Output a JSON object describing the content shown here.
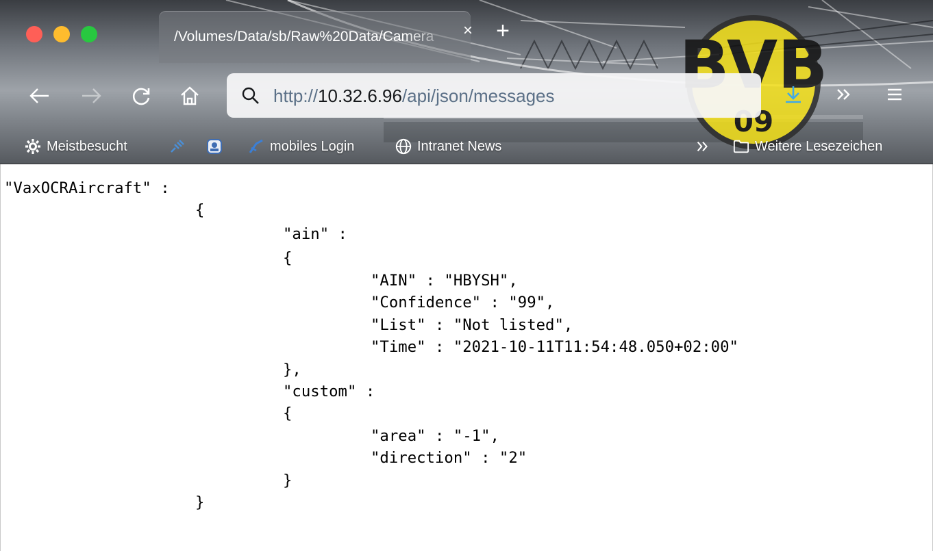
{
  "window": {
    "controls": [
      "close",
      "minimize",
      "maximize"
    ],
    "traffic_colors": {
      "close": "#fe5f57",
      "minimize": "#febc2e",
      "maximize": "#28c840"
    }
  },
  "tab": {
    "title": "/Volumes/Data/sb/Raw%20Data/Camera",
    "close_icon": "close-icon",
    "new_tab_icon": "plus-icon"
  },
  "toolbar": {
    "back_icon": "back-arrow-icon",
    "forward_icon": "forward-arrow-icon",
    "reload_icon": "reload-icon",
    "home_icon": "home-icon",
    "downloads_icon": "download-icon",
    "overflow_icon": "chevron-double-right-icon",
    "menu_icon": "hamburger-menu-icon"
  },
  "url": {
    "scheme": "http://",
    "host": "10.32.6.96",
    "path": "/api/json/messages"
  },
  "bookmarks": {
    "items": [
      {
        "label": "Meistbesucht",
        "icon": "gear-icon"
      },
      {
        "label": "",
        "icon": "link-favicon-icon"
      },
      {
        "label": "",
        "icon": "app-favicon-icon"
      },
      {
        "label": "mobiles Login",
        "icon": "mobiles-login-favicon-icon"
      },
      {
        "label": "Intranet News",
        "icon": "globe-icon"
      }
    ],
    "overflow_icon": "chevron-double-right-icon",
    "other_bookmarks": "Weitere Lesezeichen",
    "other_bookmarks_icon": "folder-icon"
  },
  "theme": {
    "badge_text": [
      "BVB",
      "09"
    ],
    "badge_color": "#f5e11a"
  },
  "json_content": {
    "lines": [
      "\"VaxOCRAircraft\" :",
      "{",
      "\"ain\" :",
      "{",
      "\"AIN\" : \"HBYSH\",",
      "\"Confidence\" : \"99\",",
      "\"List\" : \"Not listed\",",
      "\"Time\" : \"2021-10-11T11:54:48.050+02:00\"",
      "},",
      "\"custom\" :",
      "{",
      "\"area\" : \"-1\",",
      "\"direction\" : \"2\"",
      "}",
      "}"
    ]
  }
}
